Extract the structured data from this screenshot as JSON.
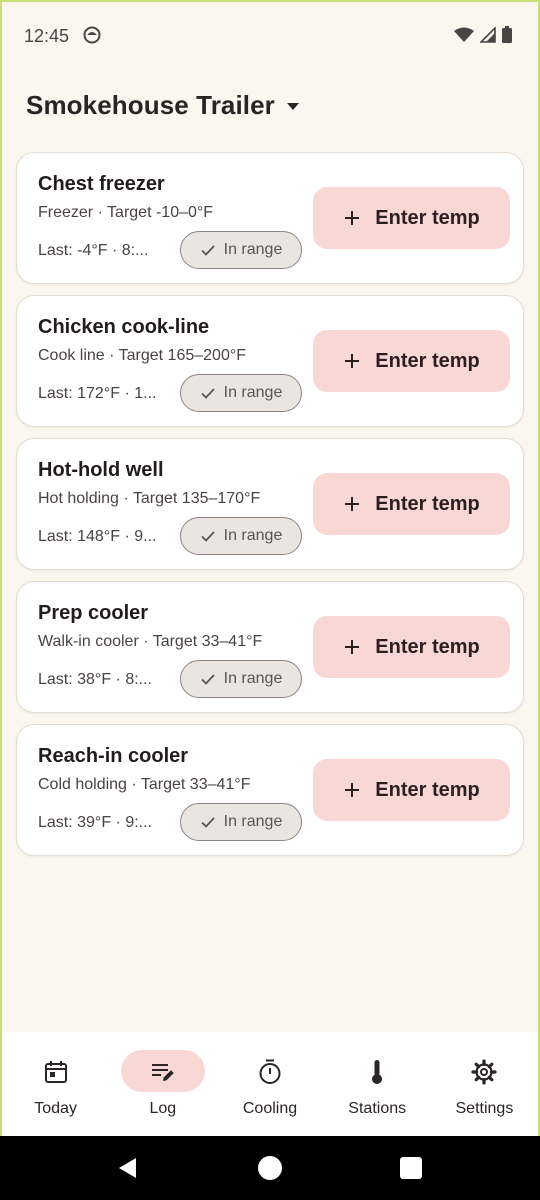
{
  "status": {
    "time": "12:45"
  },
  "header": {
    "title": "Smokehouse Trailer"
  },
  "stations": [
    {
      "name": "Chest freezer",
      "subtitle": "Freezer · Target -10–0°F",
      "last": "Last: -4°F · 8:...",
      "status": "In range",
      "action": "Enter temp"
    },
    {
      "name": "Chicken cook-line",
      "subtitle": "Cook line · Target 165–200°F",
      "last": "Last: 172°F · 1...",
      "status": "In range",
      "action": "Enter temp"
    },
    {
      "name": "Hot-hold well",
      "subtitle": "Hot holding · Target 135–170°F",
      "last": "Last: 148°F · 9...",
      "status": "In range",
      "action": "Enter temp"
    },
    {
      "name": "Prep cooler",
      "subtitle": "Walk-in cooler · Target 33–41°F",
      "last": "Last: 38°F · 8:...",
      "status": "In range",
      "action": "Enter temp"
    },
    {
      "name": "Reach-in cooler",
      "subtitle": "Cold holding · Target 33–41°F",
      "last": "Last: 39°F · 9:...",
      "status": "In range",
      "action": "Enter temp"
    }
  ],
  "nav": [
    {
      "label": "Today",
      "icon": "calendar-icon"
    },
    {
      "label": "Log",
      "icon": "edit-list-icon",
      "active": true
    },
    {
      "label": "Cooling",
      "icon": "timer-icon"
    },
    {
      "label": "Stations",
      "icon": "thermometer-icon"
    },
    {
      "label": "Settings",
      "icon": "gear-icon"
    }
  ],
  "colors": {
    "accent": "#f9d7d5",
    "background": "#fbf6ee",
    "card": "#ffffff"
  }
}
